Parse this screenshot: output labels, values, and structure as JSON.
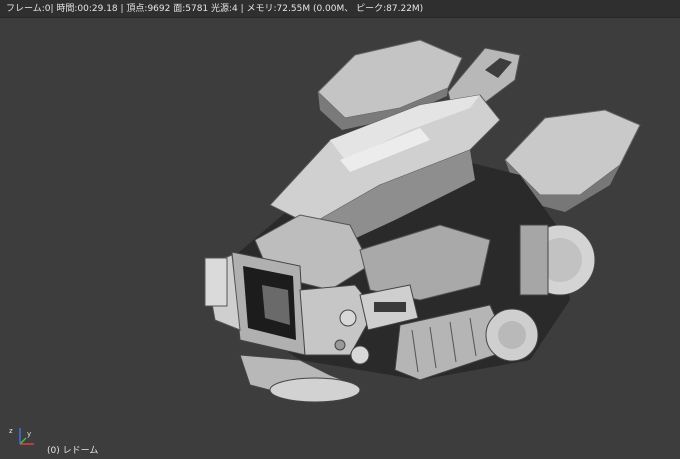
{
  "status_bar": {
    "text": "フレーム:0| 時間:00:29.18 | 頂点:9692 面:5781 光源:4 | メモリ:72.55M (0.00M、 ピーク:87.22M)"
  },
  "viewport": {
    "object_label": "(0) レドーム",
    "model": "gray-mechanical-head-render"
  },
  "axis_gizmo": {
    "x_color": "#e04040",
    "y_color": "#40c040",
    "z_color": "#4070e0",
    "z_label": "z",
    "y_label": "y"
  },
  "colors": {
    "background": "#3d3d3d",
    "statusbar": "#2f2f2f",
    "text": "#e6e6e6"
  }
}
